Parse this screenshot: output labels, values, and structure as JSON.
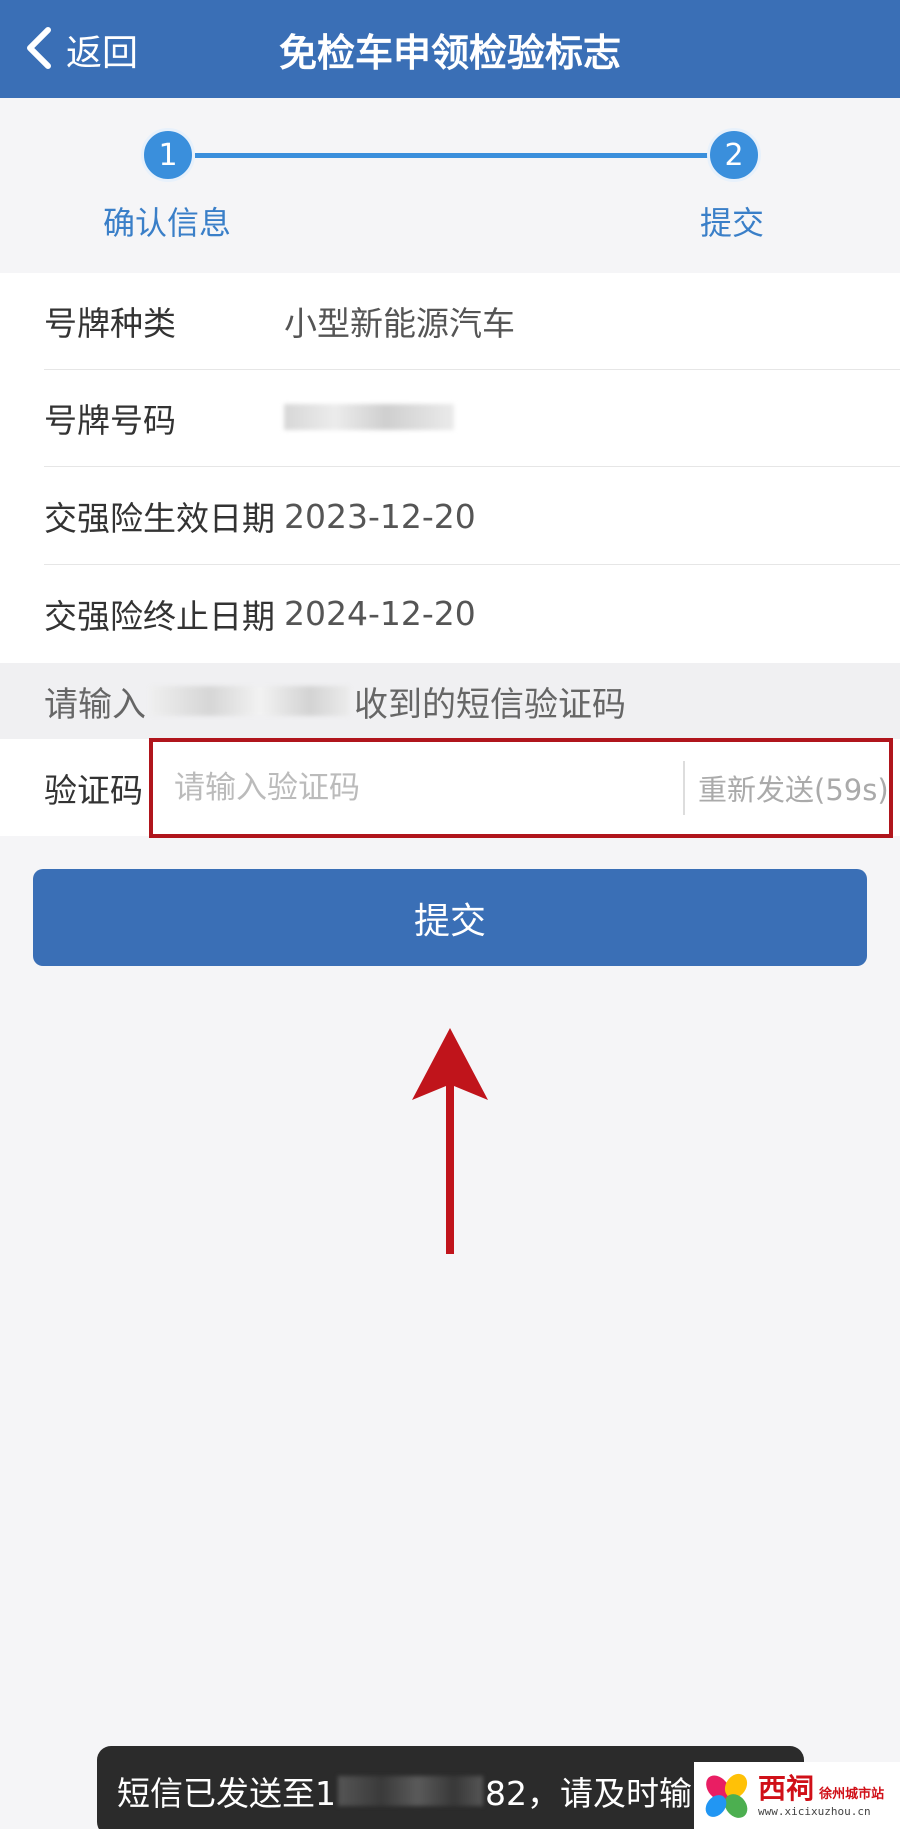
{
  "header": {
    "back_label": "返回",
    "title": "免检车申领检验标志"
  },
  "stepper": {
    "steps": [
      {
        "number": "1",
        "label": "确认信息"
      },
      {
        "number": "2",
        "label": "提交"
      }
    ]
  },
  "info": {
    "rows": [
      {
        "label": "号牌种类",
        "value": "小型新能源汽车"
      },
      {
        "label": "号牌号码",
        "value": ""
      },
      {
        "label": "交强险生效日期",
        "value": "2023-12-20"
      },
      {
        "label": "交强险终止日期",
        "value": "2024-12-20"
      }
    ]
  },
  "sms": {
    "prompt_prefix": "请输入",
    "prompt_suffix": "收到的短信验证码"
  },
  "code": {
    "label": "验证码",
    "placeholder": "请输入验证码",
    "value": "",
    "resend_label": "重新发送(59s)"
  },
  "submit": {
    "label": "提交"
  },
  "toast": {
    "prefix": "短信已发送至1",
    "suffix": "82，请及时输"
  },
  "watermark": {
    "brand": "西祠",
    "city": "徐州城市站",
    "url": "www.xicixuzhou.cn"
  },
  "colors": {
    "header": "#3a6fb6",
    "step_accent": "#3a8fdc",
    "highlight": "#b0151c",
    "arrow": "#c0141b"
  },
  "icons": {
    "back": "chevron-left-icon",
    "arrow": "arrow-up-icon"
  }
}
